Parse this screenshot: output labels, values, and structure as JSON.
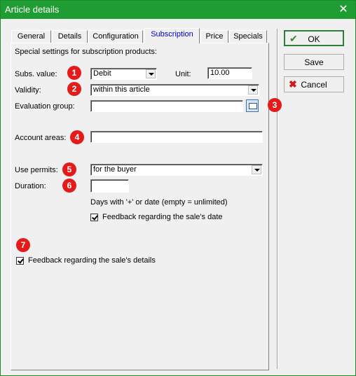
{
  "window": {
    "title": "Article details",
    "close_glyph": "✕"
  },
  "tabs": [
    {
      "label": "General"
    },
    {
      "label": "Details"
    },
    {
      "label": "Configuration"
    },
    {
      "label": "Subscription"
    },
    {
      "label": "Price"
    },
    {
      "label": "Specials"
    }
  ],
  "active_tab": "Subscription",
  "form": {
    "intro": "Special settings for subscription products:",
    "subs_value_label": "Subs. value:",
    "subs_value": "Debit",
    "unit_label": "Unit:",
    "unit_value": "10.00",
    "validity_label": "Validity:",
    "validity_value": "within this article",
    "evaluation_group_label": "Evaluation group:",
    "evaluation_group_value": "",
    "account_areas_label": "Account areas:",
    "account_areas_value": "",
    "use_permits_label": "Use permits:",
    "use_permits_value": "for the buyer",
    "duration_label": "Duration:",
    "duration_value": "",
    "duration_hint": "Days with '+' or date (empty = unlimited)",
    "feedback_sale_date_label": "Feedback regarding the sale's date",
    "feedback_sale_date_checked": true,
    "feedback_sale_details_label": "Feedback regarding the sale's details",
    "feedback_sale_details_checked": true
  },
  "badges": [
    "1",
    "2",
    "3",
    "4",
    "5",
    "6",
    "7"
  ],
  "buttons": {
    "ok_label": "OK",
    "save_label": "Save",
    "cancel_label": "Cancel",
    "ok_icon": "check-icon",
    "cancel_icon": "x-icon"
  },
  "colors": {
    "titlebar": "#1f9d33",
    "badge": "#e31b1b",
    "active_tab_text": "#0000c0"
  }
}
